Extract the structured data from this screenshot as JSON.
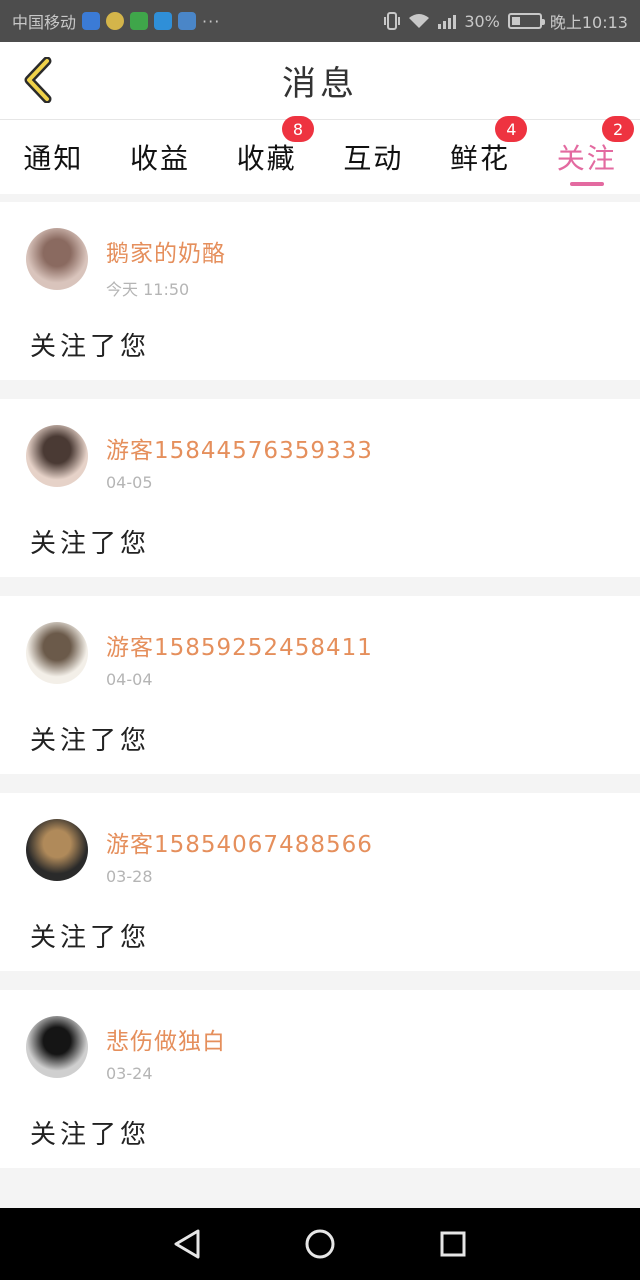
{
  "status_bar": {
    "carrier": "中国移动",
    "dots": "···",
    "battery": "30%",
    "time": "晚上10:13"
  },
  "header": {
    "title": "消息"
  },
  "tabs": [
    {
      "label": "通知",
      "badge": "",
      "active": false
    },
    {
      "label": "收益",
      "badge": "",
      "active": false
    },
    {
      "label": "收藏",
      "badge": "8",
      "active": false
    },
    {
      "label": "互动",
      "badge": "",
      "active": false
    },
    {
      "label": "鲜花",
      "badge": "4",
      "active": false
    },
    {
      "label": "关注",
      "badge": "2",
      "active": true
    }
  ],
  "notifications": [
    {
      "username": "鹅家的奶酪",
      "time": "今天 11:50",
      "action": "关注了您",
      "avatar_colors": [
        "#d9c4bc",
        "#8a6a60"
      ]
    },
    {
      "username": "游客15844576359333",
      "time": "04-05",
      "action": "关注了您",
      "avatar_colors": [
        "#e6d2c8",
        "#4a3a34"
      ]
    },
    {
      "username": "游客15859252458411",
      "time": "04-04",
      "action": "关注了您",
      "avatar_colors": [
        "#f3efe8",
        "#6b5a4a"
      ]
    },
    {
      "username": "游客15854067488566",
      "time": "03-28",
      "action": "关注了您",
      "avatar_colors": [
        "#2a2a2a",
        "#b08a5a"
      ]
    },
    {
      "username": "悲伤做独白",
      "time": "03-24",
      "action": "关注了您",
      "avatar_colors": [
        "#cfcfcf",
        "#151515"
      ]
    }
  ],
  "colors": {
    "accent": "#e36aa0",
    "username": "#e58f5c",
    "badge": "#ee3340"
  },
  "icons": {
    "back": "chevron-left-icon",
    "nav_back": "triangle-back-icon",
    "nav_home": "circle-home-icon",
    "nav_recent": "square-recent-icon"
  }
}
